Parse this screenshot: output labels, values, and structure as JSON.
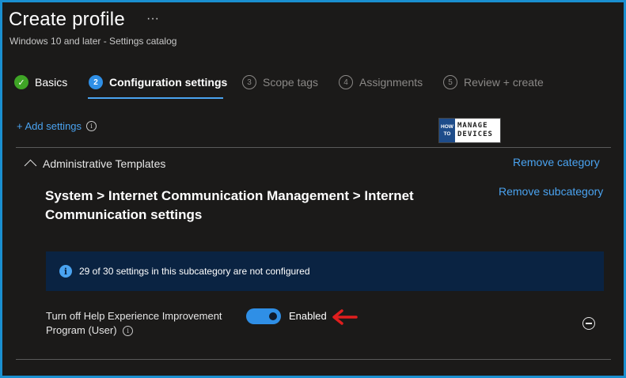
{
  "page": {
    "title": "Create profile",
    "more_label": "···",
    "subtitle": "Windows 10 and later - Settings catalog"
  },
  "steps": [
    {
      "num": "✓",
      "label": "Basics",
      "state": "done"
    },
    {
      "num": "2",
      "label": "Configuration settings",
      "state": "active"
    },
    {
      "num": "3",
      "label": "Scope tags",
      "state": "pending"
    },
    {
      "num": "4",
      "label": "Assignments",
      "state": "pending"
    },
    {
      "num": "5",
      "label": "Review + create",
      "state": "pending"
    }
  ],
  "add_settings_label": "+ Add settings",
  "info_glyph": "i",
  "logo": {
    "left_line1": "HOW",
    "left_line2": "TO",
    "right_line1": "MANAGE",
    "right_line2": "DEVICES"
  },
  "category": {
    "name": "Administrative Templates",
    "remove_label": "Remove category"
  },
  "subcategory": {
    "title": "System > Internet Communication Management > Internet Communication settings",
    "remove_label": "Remove subcategory"
  },
  "banner": {
    "text": "29 of 30 settings in this subcategory are not configured"
  },
  "setting": {
    "name": "Turn off Help Experience Improvement Program (User)",
    "state_label": "Enabled",
    "enabled": true
  },
  "colors": {
    "accent": "#2f8fe6",
    "link": "#4aa3f0",
    "success": "#3fa526",
    "banner_bg": "#0a2342",
    "arrow": "#e01e1e",
    "frame": "#1a8fd0"
  }
}
